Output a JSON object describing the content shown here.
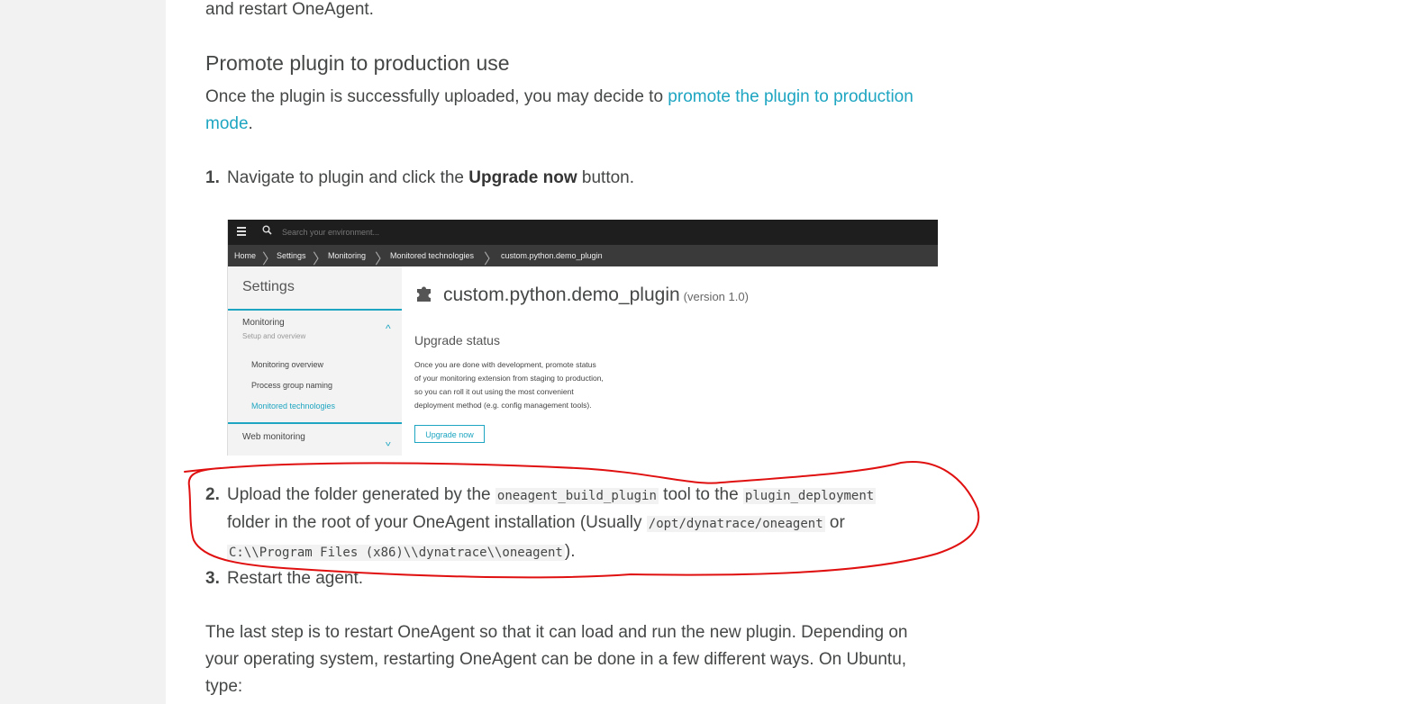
{
  "article": {
    "intro_tail": "and restart OneAgent.",
    "section_heading": "Promote plugin to production use",
    "para1_text": "Once the plugin is successfully uploaded, you may decide to ",
    "para1_link_a": "promote the plugin to production",
    "para1_link_b": "mode",
    "para1_end": ".",
    "steps": [
      {
        "num": "1.",
        "pre": "Navigate to plugin and click the ",
        "bold": "Upgrade now",
        "post": " button."
      },
      {
        "num": "2.",
        "line1_pre": "Upload the folder generated by the ",
        "code1": "oneagent_build_plugin",
        "line1_mid": " tool to the ",
        "code2": "plugin_deployment",
        "line2_pre": "folder in the root of your OneAgent installation (Usually ",
        "code3": "/opt/dynatrace/oneagent",
        "line2_post": " or",
        "code4": "C:\\\\Program Files (x86)\\\\dynatrace\\\\oneagent",
        "line3_post": ")."
      },
      {
        "num": "3.",
        "text": "Restart the agent."
      }
    ],
    "closing_line1": "The last step is to restart OneAgent so that it can load and run the new plugin. Depending on",
    "closing_line2": "your operating system, restarting OneAgent can be done in a few different ways. On Ubuntu,",
    "closing_line3": "type:"
  },
  "screenshot": {
    "search_placeholder": "Search your environment...",
    "breadcrumbs": [
      "Home",
      "Settings",
      "Monitoring",
      "Monitored technologies",
      "custom.python.demo_plugin"
    ],
    "sidebar": {
      "title": "Settings",
      "section": "Monitoring",
      "section_sub": "Setup and overview",
      "items": [
        "Monitoring overview",
        "Process group naming",
        "Monitored technologies"
      ],
      "next_section": "Web monitoring"
    },
    "plugin_name": "custom.python.demo_plugin",
    "plugin_version": "(version 1.0)",
    "upgrade_heading": "Upgrade status",
    "upgrade_desc": [
      "Once you are done with development, promote status",
      "of your monitoring extension from staging to production,",
      "so you can roll it out using the most convenient",
      "deployment method (e.g. config management tools)."
    ],
    "upgrade_button": "Upgrade now"
  },
  "colors": {
    "link": "#1da5c1",
    "text": "#454646",
    "annotation": "#e01010",
    "gutter": "#f2f2f2"
  },
  "icons": [
    "menu-icon",
    "search-icon",
    "puzzle-icon",
    "chevron-up-icon",
    "chevron-down-icon"
  ]
}
